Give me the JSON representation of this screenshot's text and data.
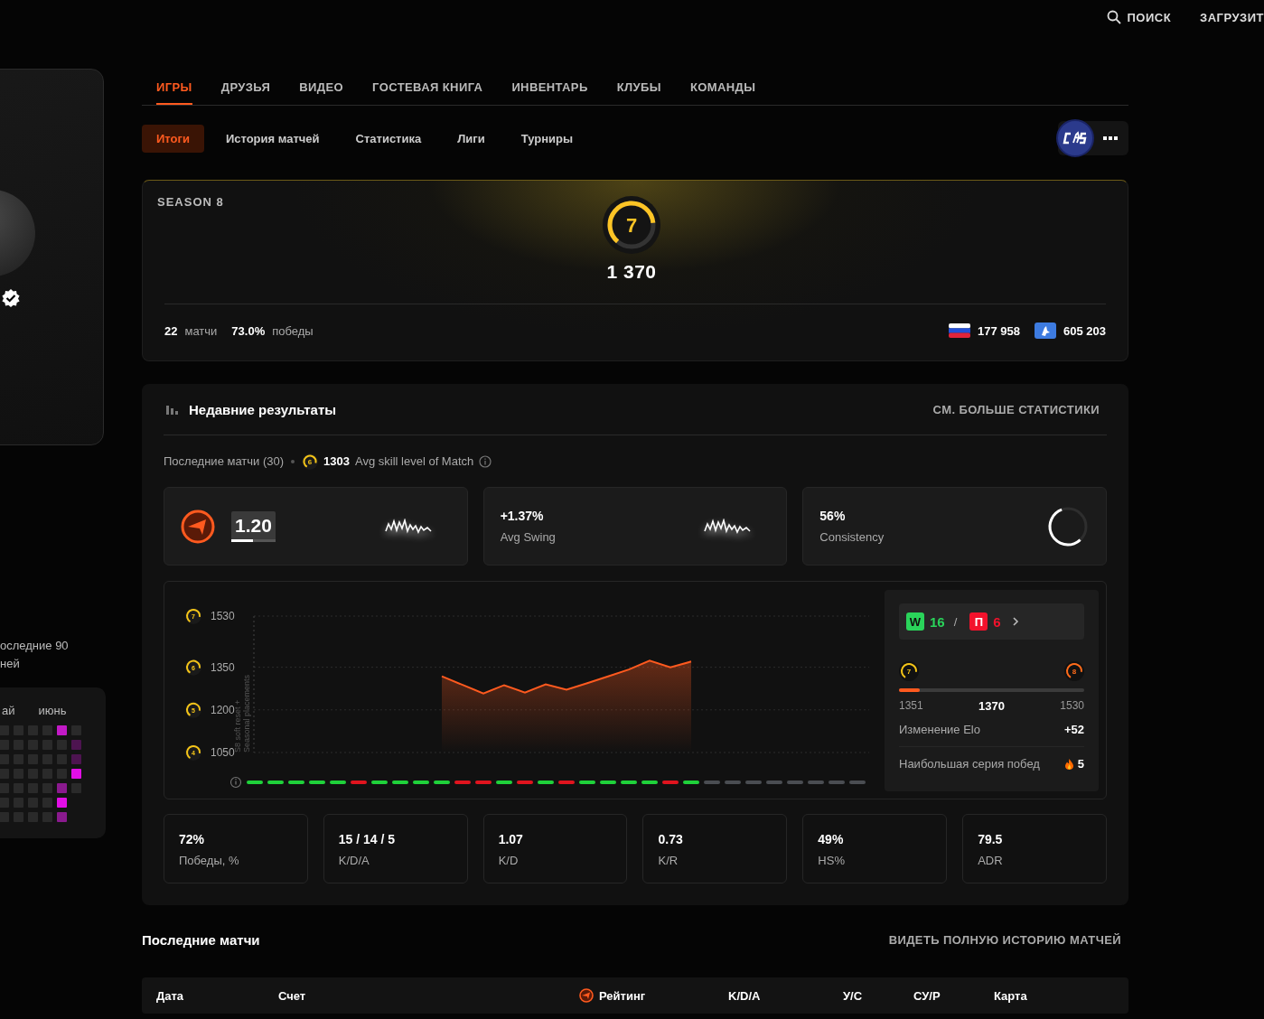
{
  "top_bar": {
    "items": [
      {
        "kind": "search",
        "label": "ПОИСК"
      },
      {
        "kind": "link",
        "label": "ЗАГРУЗИТ"
      }
    ]
  },
  "profile_card": {
    "verified": true
  },
  "activity": {
    "caption_lines": [
      "оследние 90",
      "ней"
    ],
    "months": [
      "ай",
      "июнь"
    ],
    "columns": [
      {
        "cells": [
          {
            "color": "#2a2a2a"
          },
          {
            "color": "#2a2a2a"
          },
          {
            "color": "#2a2a2a"
          },
          {
            "color": "#2a2a2a"
          },
          {
            "color": "#2a2a2a"
          },
          {
            "color": "#2a2a2a"
          },
          {
            "color": "#2a2a2a"
          }
        ]
      },
      {
        "cells": [
          {
            "color": "#2a2a2a"
          },
          {
            "color": "#2a2a2a"
          },
          {
            "color": "#2a2a2a"
          },
          {
            "color": "#2a2a2a"
          },
          {
            "color": "#2a2a2a"
          },
          {
            "color": "#2a2a2a"
          },
          {
            "color": "#2a2a2a"
          }
        ]
      },
      {
        "cells": [
          {
            "color": "#2a2a2a"
          },
          {
            "color": "#2a2a2a"
          },
          {
            "color": "#2a2a2a"
          },
          {
            "color": "#2a2a2a"
          },
          {
            "color": "#2a2a2a"
          },
          {
            "color": "#2a2a2a"
          },
          {
            "color": "#2a2a2a"
          }
        ]
      },
      {
        "cells": [
          {
            "color": "#2a2a2a"
          },
          {
            "color": "#2a2a2a"
          },
          {
            "color": "#2a2a2a"
          },
          {
            "color": "#2a2a2a"
          },
          {
            "color": "#2a2a2a"
          },
          {
            "color": "#2a2a2a"
          },
          {
            "color": "#2a2a2a"
          }
        ]
      },
      {
        "cells": [
          {
            "color": "#c21ac6"
          },
          {
            "color": "#2a2a2a"
          },
          {
            "color": "#2a2a2a"
          },
          {
            "color": "#2a2a2a"
          },
          {
            "color": "#8a1a8e"
          },
          {
            "color": "#e20ee6"
          },
          {
            "color": "#8a1a8e"
          }
        ]
      },
      {
        "cells": [
          {
            "color": "#2a2a2a"
          },
          {
            "color": "#4d1450"
          },
          {
            "color": "#4d1450"
          },
          {
            "color": "#e20ee6"
          },
          {
            "color": "#2a2a2a"
          }
        ]
      }
    ]
  },
  "tabs": [
    {
      "label": "ИГРЫ",
      "selected": true
    },
    {
      "label": "ДРУЗЬЯ",
      "selected": false
    },
    {
      "label": "ВИДЕО",
      "selected": false
    },
    {
      "label": "ГОСТЕВАЯ КНИГА",
      "selected": false
    },
    {
      "label": "ИНВЕНТАРЬ",
      "selected": false
    },
    {
      "label": "КЛУБЫ",
      "selected": false
    },
    {
      "label": "КОМАНДЫ",
      "selected": false
    }
  ],
  "subtabs": [
    {
      "label": "Итоги",
      "selected": true
    },
    {
      "label": "История матчей",
      "selected": false
    },
    {
      "label": "Статистика",
      "selected": false
    },
    {
      "label": "Лиги",
      "selected": false
    },
    {
      "label": "Турниры",
      "selected": false
    }
  ],
  "season": {
    "title": "SEASON 8",
    "skill_level": "7",
    "elo": "1 370",
    "matches": "22",
    "matches_label": "матчи",
    "winrate": "73.0%",
    "winrate_label": "победы",
    "country_rank": "177 958",
    "region_rank": "605 203"
  },
  "recent": {
    "title": "Недавние результаты",
    "more_link": "СМ. БОЛЬШЕ СТАТИСТИКИ",
    "summary": "Последние матчи (30)",
    "avg_badge": "6",
    "avg_elo": "1303",
    "avg_label": "Avg skill level of Match",
    "cards": [
      {
        "kind": "rating",
        "value": "1.20",
        "level": 0.5
      },
      {
        "kind": "swing",
        "value": "+1.37%",
        "label": "Avg Swing"
      },
      {
        "kind": "consistency",
        "value": "56%",
        "label": "Consistency",
        "level": 0.56
      }
    ],
    "chart": {
      "chart_data": {
        "type": "line",
        "series": [
          {
            "color": "#ff5a1f",
            "values": [
              null,
              null,
              null,
              null,
              null,
              null,
              null,
              null,
              null,
              1318,
              1288,
              1258,
              1287,
              1261,
              1290,
              1271,
              1294,
              1318,
              1342,
              1373,
              1350,
              1370,
              null,
              null,
              null,
              null,
              null,
              null,
              null,
              null
            ]
          }
        ],
        "ylim": [
          1050,
          1530
        ],
        "yticks": [
          1530,
          1350,
          1200,
          1050
        ],
        "annotations": [
          {
            "text": "S8 soft reset +"
          },
          {
            "text": "Seasonal placements"
          }
        ]
      },
      "tick_badges": [
        "7",
        "6",
        "5",
        "4"
      ],
      "results": [
        {
          "kind": "win"
        },
        {
          "kind": "win"
        },
        {
          "kind": "win"
        },
        {
          "kind": "win"
        },
        {
          "kind": "win"
        },
        {
          "kind": "loss"
        },
        {
          "kind": "win"
        },
        {
          "kind": "win"
        },
        {
          "kind": "win"
        },
        {
          "kind": "win"
        },
        {
          "kind": "loss"
        },
        {
          "kind": "loss"
        },
        {
          "kind": "win"
        },
        {
          "kind": "loss"
        },
        {
          "kind": "win"
        },
        {
          "kind": "loss"
        },
        {
          "kind": "win"
        },
        {
          "kind": "win"
        },
        {
          "kind": "win"
        },
        {
          "kind": "win"
        },
        {
          "kind": "loss"
        },
        {
          "kind": "win"
        },
        {
          "kind": "pending"
        },
        {
          "kind": "pending"
        },
        {
          "kind": "pending"
        },
        {
          "kind": "pending"
        },
        {
          "kind": "pending"
        },
        {
          "kind": "pending"
        },
        {
          "kind": "pending"
        },
        {
          "kind": "pending"
        }
      ]
    },
    "summary_panel": {
      "wins_badge": "W",
      "wins": "16",
      "separator": "/",
      "losses_badge": "П",
      "losses": "6",
      "levels": [
        {
          "label": "7",
          "color": "#f5c518"
        },
        {
          "label": "8",
          "color": "#ff6b1a"
        }
      ],
      "level": 0.11,
      "from_elo": "1351",
      "current_elo": "1370",
      "to_elo": "1530",
      "rows": [
        {
          "kind": "plain",
          "label": "Изменение Elo",
          "value": "+52"
        },
        {
          "kind": "streak",
          "label": "Наибольшая серия побед",
          "value": "5"
        }
      ]
    },
    "stats": [
      {
        "value": "72%",
        "label": "Победы, %"
      },
      {
        "value": "15 / 14 / 5",
        "label": "K/D/A"
      },
      {
        "value": "1.07",
        "label": "K/D"
      },
      {
        "value": "0.73",
        "label": "K/R"
      },
      {
        "value": "49%",
        "label": "HS%"
      },
      {
        "value": "79.5",
        "label": "ADR"
      }
    ]
  },
  "matches": {
    "title": "Последние матчи",
    "link": "ВИДЕТЬ ПОЛНУЮ ИСТОРИЮ МАТЧЕЙ",
    "columns": [
      {
        "kind": "plain",
        "label": "Дата"
      },
      {
        "kind": "plain",
        "label": "Счет"
      },
      {
        "kind": "rating",
        "label": "Рейтинг"
      },
      {
        "kind": "plain",
        "label": "K/D/A"
      },
      {
        "kind": "plain",
        "label": "У/С"
      },
      {
        "kind": "plain",
        "label": "СУ/Р"
      },
      {
        "kind": "plain",
        "label": "Карта"
      }
    ]
  }
}
